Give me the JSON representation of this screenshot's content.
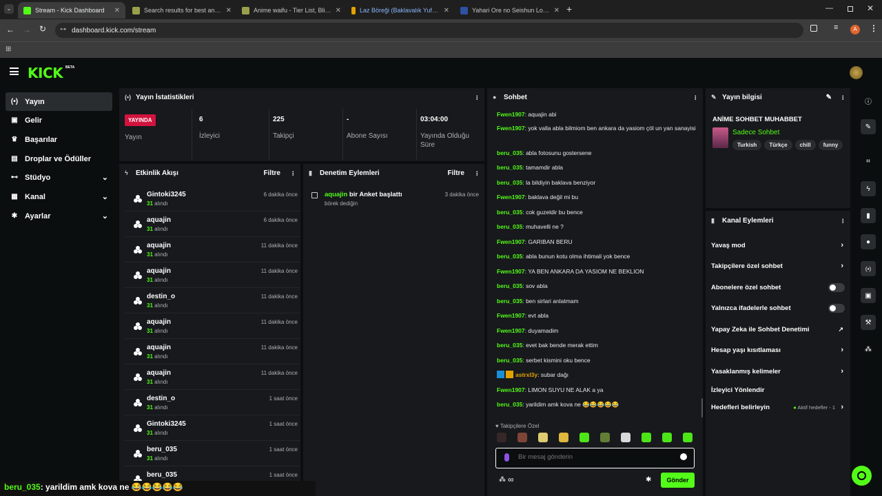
{
  "browser": {
    "tabs": [
      {
        "title": "Stream - Kick Dashboard",
        "fav_color": "#53fc18",
        "active": true
      },
      {
        "title": "Search results for best anime -",
        "fav_color": "#9aa04a",
        "active": false
      },
      {
        "title": "Anime waifu - Tier List, Blind Ra",
        "fav_color": "#9aa04a",
        "active": false
      },
      {
        "title": "Laz Böreği (Baklavalık Yufkadan",
        "fav_color": "#e2a200",
        "active": false
      },
      {
        "title": "Yahari Ore no Seishun Love Co",
        "fav_color": "#2e51a2",
        "active": false
      }
    ],
    "url": "dashboard.kick.com/stream",
    "profile_initial": "A"
  },
  "brand": {
    "logo": "KICK",
    "beta": "BETA"
  },
  "sidebar": {
    "items": [
      {
        "label": "Yayın",
        "icon": "broadcast-icon"
      },
      {
        "label": "Gelir",
        "icon": "revenue-icon"
      },
      {
        "label": "Başarılar",
        "icon": "trophy-icon"
      },
      {
        "label": "Droplar ve Ödüller",
        "icon": "gift-icon"
      },
      {
        "label": "Stüdyo",
        "icon": "studio-icon"
      },
      {
        "label": "Kanal",
        "icon": "channel-icon"
      },
      {
        "label": "Ayarlar",
        "icon": "gear-icon"
      }
    ]
  },
  "stats": {
    "title": "Yayın İstatistikleri",
    "live_badge": "YAYINDA",
    "live_label": "Yayın",
    "items": [
      {
        "value": "6",
        "label": "İzleyici"
      },
      {
        "value": "225",
        "label": "Takipçi"
      },
      {
        "value": "-",
        "label": "Abone Sayısı"
      },
      {
        "value": "03:04:00",
        "label": "Yayında Olduğu Süre"
      }
    ]
  },
  "activity": {
    "title": "Etkinlik Akışı",
    "filter": "Filtre",
    "unit_label": "alındı",
    "events": [
      {
        "user": "Gintoki3245",
        "amount": "31",
        "time": "6 dakika önce"
      },
      {
        "user": "aquajin",
        "amount": "31",
        "time": "6 dakika önce"
      },
      {
        "user": "aquajin",
        "amount": "31",
        "time": "11 dakika önce"
      },
      {
        "user": "aquajin",
        "amount": "31",
        "time": "11 dakika önce"
      },
      {
        "user": "destin_o",
        "amount": "31",
        "time": "11 dakika önce"
      },
      {
        "user": "aquajin",
        "amount": "31",
        "time": "11 dakika önce"
      },
      {
        "user": "aquajin",
        "amount": "31",
        "time": "11 dakika önce"
      },
      {
        "user": "aquajin",
        "amount": "31",
        "time": "11 dakika önce"
      },
      {
        "user": "destin_o",
        "amount": "31",
        "time": "1 saat önce"
      },
      {
        "user": "Gintoki3245",
        "amount": "31",
        "time": "1 saat önce"
      },
      {
        "user": "beru_035",
        "amount": "31",
        "time": "1 saat önce"
      },
      {
        "user": "beru_035",
        "amount": "31",
        "time": "1 saat önce"
      }
    ]
  },
  "moderation": {
    "title": "Denetim Eylemleri",
    "filter": "Filtre",
    "entries": [
      {
        "user": "aquajin",
        "action": "bir Anket başlattı",
        "detail": "börek dediğin",
        "time": "3 dakika önce"
      }
    ]
  },
  "chat": {
    "title": "Sohbet",
    "messages": [
      {
        "user": "Fwen1907",
        "text": "aquajin abi"
      },
      {
        "user": "Fwen1907",
        "text": "yok valla abla bilmiom ben ankara da yasiom çöl un yan sanayisi"
      },
      {
        "user": "beru_035",
        "text": "abla fotosunu gostersene"
      },
      {
        "user": "beru_035",
        "text": "tamamdir abla"
      },
      {
        "user": "beru_035",
        "text": "la bildiyin baklava benziyor"
      },
      {
        "user": "Fwen1907",
        "text": "baklava değil mi bu"
      },
      {
        "user": "beru_035",
        "text": "cok guzeldir bu bence"
      },
      {
        "user": "beru_035",
        "text": "muhavelli ne ?"
      },
      {
        "user": "Fwen1907",
        "text": "GARIBAN BERU"
      },
      {
        "user": "beru_035",
        "text": "abla bunun kotu olma ihtimali yok bence"
      },
      {
        "user": "Fwen1907",
        "text": "YA BEN ANKARA DA YASIOM NE BEKLION"
      },
      {
        "user": "beru_035",
        "text": "sov abla"
      },
      {
        "user": "beru_035",
        "text": "ben sirlari anlatmam"
      },
      {
        "user": "Fwen1907",
        "text": "evt abla"
      },
      {
        "user": "Fwen1907",
        "text": "duyamadim"
      },
      {
        "user": "beru_035",
        "text": "evet bak bende merak ettim"
      },
      {
        "user": "beru_035",
        "text": "serbet kismini oku bence"
      },
      {
        "user": "astrxl3y",
        "text": "subar dağı"
      },
      {
        "user": "Fwen1907",
        "text": "LIMON SUYU NE ALAK a ya"
      },
      {
        "user": "beru_035",
        "text": "yarildim amk kova ne 😂😂😂😂😂"
      }
    ],
    "emote_section": "Takipçilere Özel",
    "input_placeholder": "Bir mesaj gönderin",
    "send_label": "Gönder"
  },
  "stream_info": {
    "title": "Yayın bilgisi",
    "stream_title": "ANİME SOHBET MUHABBET",
    "category": "Sadece Sohbet",
    "tags": [
      "Turkish",
      "Türkçe",
      "chill",
      "funny"
    ]
  },
  "channel_actions": {
    "title": "Kanal Eylemleri",
    "items": [
      {
        "label": "Yavaş mod",
        "control": "arrow"
      },
      {
        "label": "Takipçilere özel sohbet",
        "control": "arrow"
      },
      {
        "label": "Abonelere özel sohbet",
        "control": "toggle"
      },
      {
        "label": "Yalnızca ifadelerle sohbet",
        "control": "toggle"
      },
      {
        "label": "Yapay Zeka ile Sohbet Denetimi",
        "control": "external"
      },
      {
        "label": "Hesap yaşı kısıtlaması",
        "control": "arrow"
      },
      {
        "label": "Yasaklanmış kelimeler",
        "control": "arrow"
      },
      {
        "label": "İzleyici Yönlendir",
        "control": "none"
      },
      {
        "label": "Hedefleri belirleyin",
        "control": "arrow"
      }
    ],
    "goal_status": "Aktif hedefler - 1"
  },
  "overlay": {
    "user": "beru_035",
    "text": ": yarildim amk kova ne 😂😂😂😂😂"
  },
  "colors": {
    "accent": "#53fc18",
    "live": "#d2133e",
    "panel": "#17191c",
    "bg": "#0b0e0f"
  }
}
